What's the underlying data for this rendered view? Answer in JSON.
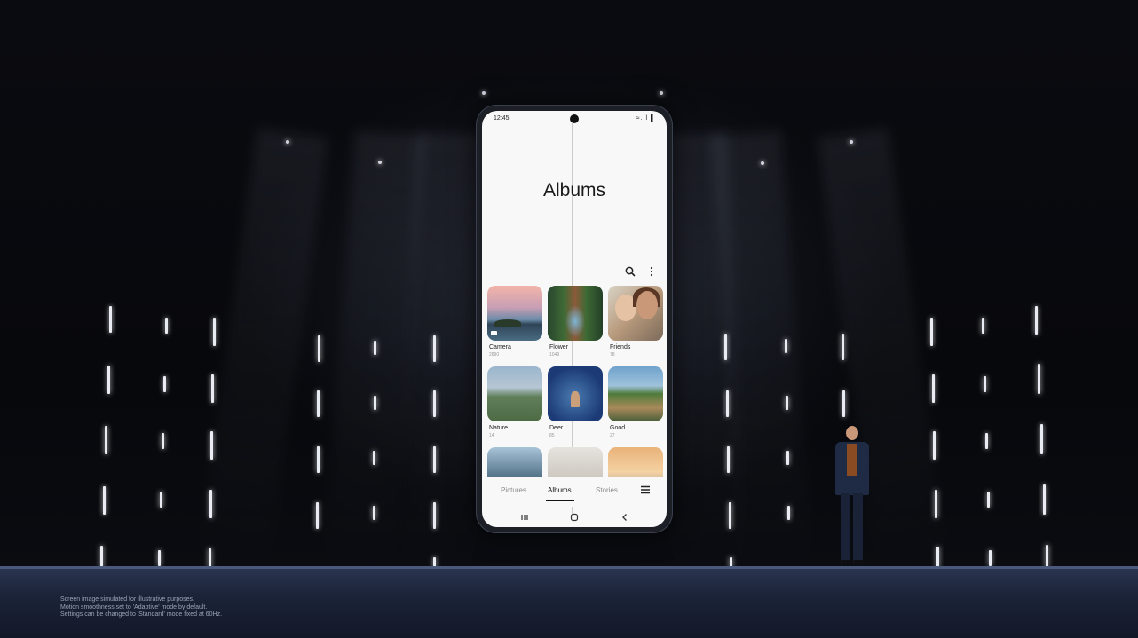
{
  "status_bar": {
    "time": "12:45",
    "icons": "≈.ıl ▌"
  },
  "app": {
    "title": "Albums"
  },
  "toolbar": {
    "search_icon": "search-icon",
    "more_icon": "more-options-icon"
  },
  "albums": [
    {
      "name": "Camera",
      "count": "2890"
    },
    {
      "name": "Flower",
      "count": "1049"
    },
    {
      "name": "Friends",
      "count": "78"
    },
    {
      "name": "Nature",
      "count": "14"
    },
    {
      "name": "Deer",
      "count": "85"
    },
    {
      "name": "Good",
      "count": "27"
    },
    {
      "name": "",
      "count": ""
    },
    {
      "name": "",
      "count": ""
    },
    {
      "name": "",
      "count": ""
    }
  ],
  "bottom_tabs": [
    {
      "label": "Pictures",
      "active": false
    },
    {
      "label": "Albums",
      "active": true
    },
    {
      "label": "Stories",
      "active": false
    }
  ],
  "disclaimer": {
    "line1": "Screen image simulated for illustrative purposes.",
    "line2": "Motion smoothness set to 'Adaptive' mode by default.",
    "line3": "Settings can be changed to 'Standard' mode fixed at 60Hz."
  },
  "colors": {
    "screen_bg": "#f8f8f8",
    "stage_bg": "#06070b",
    "floor": "#1b2338",
    "accent": "#111111"
  }
}
